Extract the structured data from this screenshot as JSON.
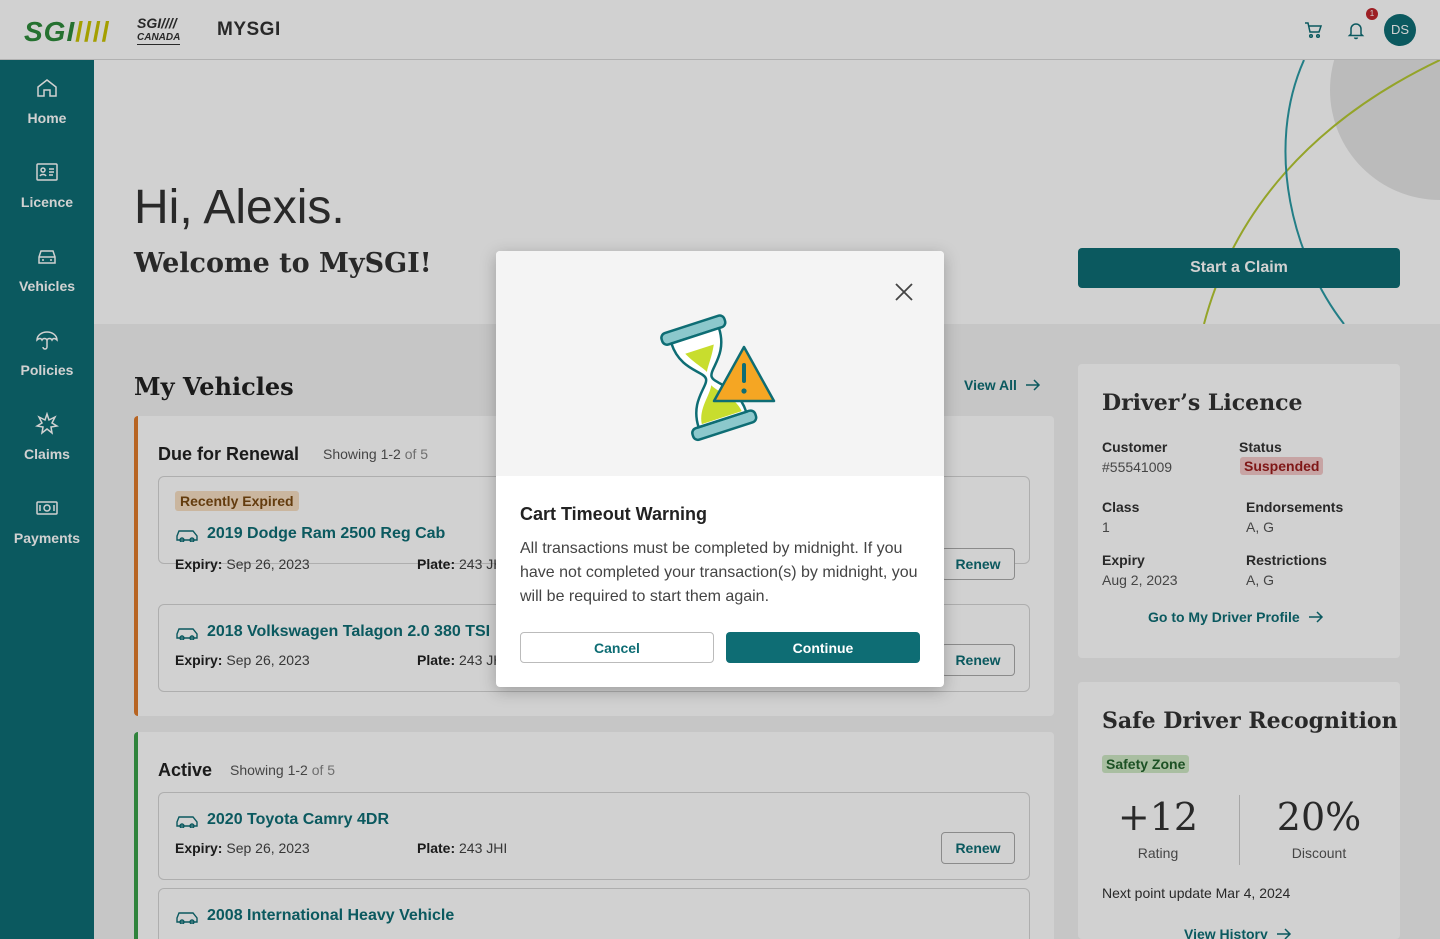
{
  "header": {
    "logo_sgi": "SGI",
    "logo_bars": "////",
    "logo_canada_top": "SGI////",
    "logo_canada_bottom": "CANADA",
    "app_name": "MYSGI",
    "notification_count": "1",
    "avatar_initials": "DS"
  },
  "sidebar": {
    "items": [
      {
        "label": "Home",
        "icon": "home-icon"
      },
      {
        "label": "Licence",
        "icon": "id-card-icon"
      },
      {
        "label": "Vehicles",
        "icon": "car-icon"
      },
      {
        "label": "Policies",
        "icon": "umbrella-icon"
      },
      {
        "label": "Claims",
        "icon": "burst-icon"
      },
      {
        "label": "Payments",
        "icon": "cash-icon"
      }
    ]
  },
  "hero": {
    "greeting": "Hi, Alexis.",
    "welcome": "Welcome to MySGI!",
    "claim_button": "Start a Claim"
  },
  "vehicles": {
    "title": "My Vehicles",
    "view_all": "View All",
    "renewal_group": {
      "title": "Due for Renewal",
      "showing": "Showing 1-2",
      "of": "of 5",
      "items": [
        {
          "tag": "Recently Expired",
          "name": "2019 Dodge Ram 2500 Reg Cab",
          "expiry_label": "Expiry:",
          "expiry": "Sep 26, 2023",
          "plate_label": "Plate:",
          "plate": "243 JH",
          "action": "Renew"
        },
        {
          "name": "2018 Volkswagen Talagon 2.0 380 TSI",
          "expiry_label": "Expiry:",
          "expiry": "Sep 26, 2023",
          "plate_label": "Plate:",
          "plate": "243 JH",
          "action": "Renew"
        }
      ]
    },
    "active_group": {
      "title": "Active",
      "showing": "Showing 1-2",
      "of": "of 5",
      "items": [
        {
          "name": "2020 Toyota Camry 4DR",
          "expiry_label": "Expiry:",
          "expiry": "Sep 26, 2023",
          "plate_label": "Plate:",
          "plate": "243 JHI",
          "action": "Renew"
        },
        {
          "name": "2008 International Heavy Vehicle"
        }
      ]
    }
  },
  "licence": {
    "title": "Driver’s Licence",
    "customer_label": "Customer",
    "customer_value": "#55541009",
    "status_label": "Status",
    "status_value": "Suspended",
    "class_label": "Class",
    "class_value": "1",
    "endorsements_label": "Endorsements",
    "endorsements_value": "A, G",
    "expiry_label": "Expiry",
    "expiry_value": "Aug 2, 2023",
    "restrictions_label": "Restrictions",
    "restrictions_value": "A, G",
    "profile_link": "Go to My Driver Profile"
  },
  "safe_driver": {
    "title": "Safe Driver Recognition",
    "zone": "Safety Zone",
    "rating_value": "+12",
    "rating_label": "Rating",
    "discount_value": "20%",
    "discount_label": "Discount",
    "next_update": "Next point update Mar 4, 2024",
    "history_link": "View History"
  },
  "modal": {
    "title": "Cart Timeout Warning",
    "body": "All transactions must be completed by midnight. If you have not completed your transaction(s) by midnight, you will be required to start them again.",
    "cancel": "Cancel",
    "continue": "Continue"
  },
  "colors": {
    "brand_teal": "#0e6d74",
    "renewal_accent": "#e07b2a",
    "active_accent": "#3aa04a",
    "logo_green": "#2e8a3b",
    "logo_yellow": "#c9c200"
  }
}
